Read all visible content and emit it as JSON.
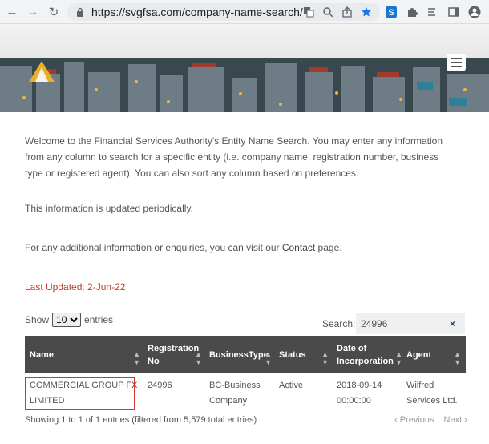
{
  "browser": {
    "url": "https://svgfsa.com/company-name-search/"
  },
  "intro": {
    "paragraph": "Welcome to the Financial Services Authority's Entity Name Search. You may enter any information from any column to search for a specific entity (i.e. company name, registration number, business type or registered agent). You can also sort any column based on preferences.",
    "updated_note": "This information is updated periodically.",
    "contact_prefix": "For any additional information or enquiries, you can visit our",
    "contact_link": "Contact",
    "contact_suffix": "page.",
    "last_updated": "Last Updated:  2-Jun-22"
  },
  "controls": {
    "show_label": "Show",
    "entries_value": "10",
    "entries_label": "entries",
    "search_label": "Search:",
    "search_value": "24996",
    "clear_symbol": "×"
  },
  "table": {
    "headers": {
      "name": "Name",
      "reg_line1": "Registration",
      "reg_line2": "No",
      "business_type": "BusinessType",
      "status": "Status",
      "doi_line1": "Date of",
      "doi_line2": "Incorporation",
      "agent": "Agent"
    },
    "rows": [
      {
        "name_line1": "COMMERCIAL GROUP FX",
        "name_line2": "LIMITED",
        "reg_no": "24996",
        "type_line1": "BC-Business",
        "type_line2": "Company",
        "status": "Active",
        "date_line1": "2018-09-14",
        "date_line2": "00:00:00",
        "agent_line1": "Wilfred",
        "agent_line2": "Services Ltd."
      }
    ],
    "info": "Showing 1 to 1 of 1 entries (filtered from 5,579 total entries)",
    "previous": "Previous",
    "next": "Next"
  },
  "colors": {
    "table_header": "#4a4a4a",
    "last_updated": "#c0392b",
    "highlight_box": "#d9342b",
    "bookmark_star": "#1a73e8"
  }
}
